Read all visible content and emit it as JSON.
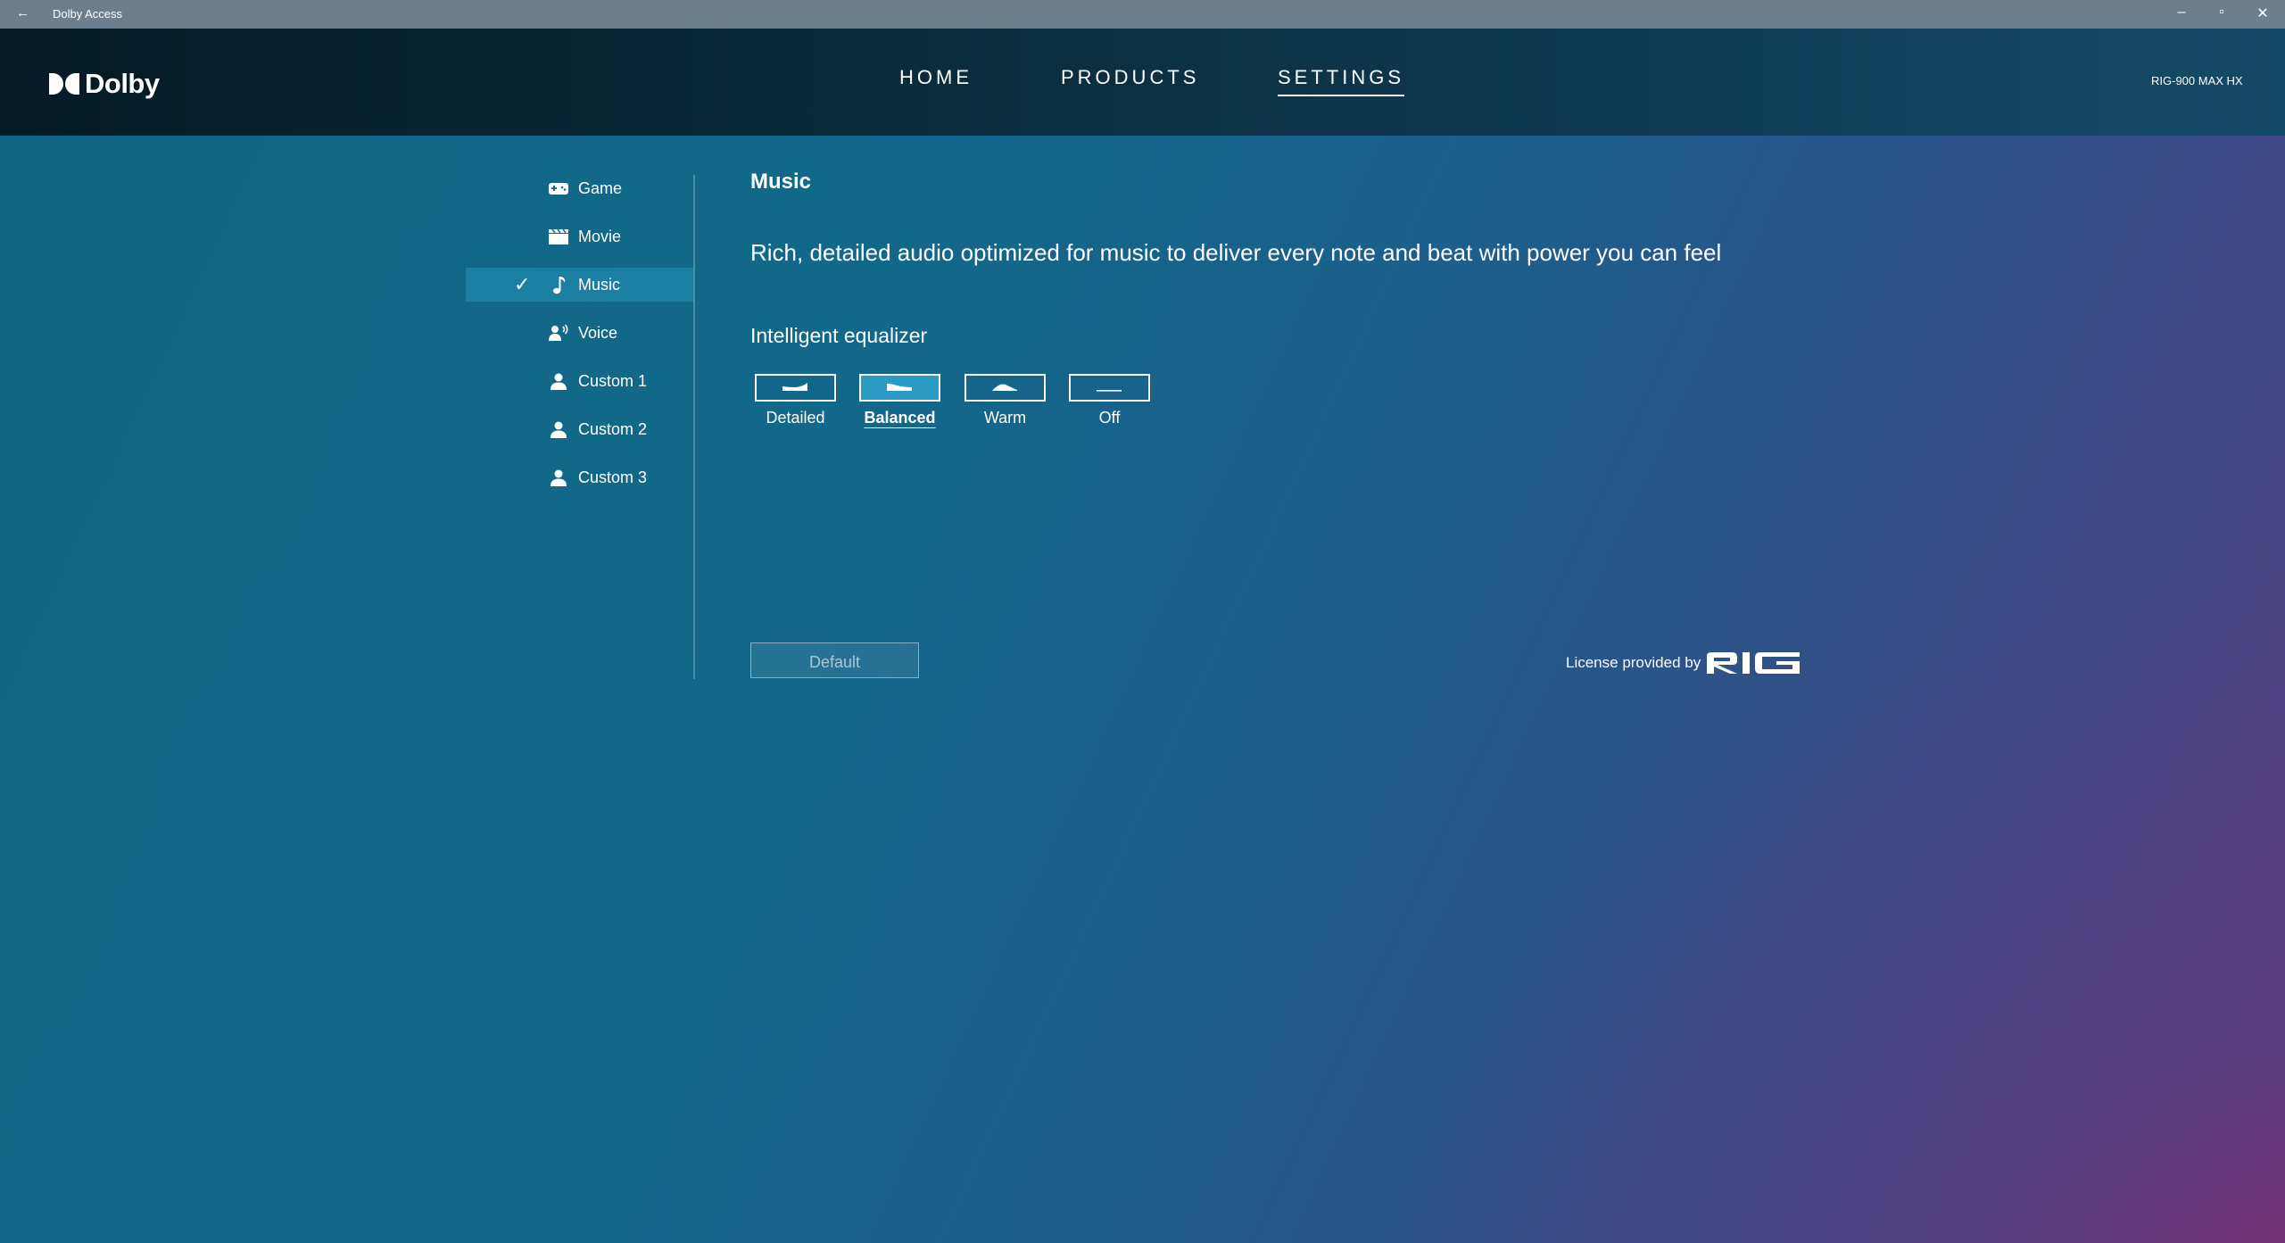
{
  "window": {
    "title": "Dolby Access",
    "back_glyph": "←",
    "minimize_glyph": "–",
    "restore_glyph": "▫",
    "close_glyph": "✕"
  },
  "header": {
    "logo_text": "Dolby",
    "nav": [
      {
        "label": "HOME",
        "active": false
      },
      {
        "label": "PRODUCTS",
        "active": false
      },
      {
        "label": "SETTINGS",
        "active": true
      }
    ],
    "device": "RIG-900 MAX HX"
  },
  "sidebar": {
    "items": [
      {
        "label": "Game",
        "icon": "gamepad-icon",
        "selected": false
      },
      {
        "label": "Movie",
        "icon": "clapperboard-icon",
        "selected": false
      },
      {
        "label": "Music",
        "icon": "music-note-icon",
        "selected": true
      },
      {
        "label": "Voice",
        "icon": "voice-icon",
        "selected": false
      },
      {
        "label": "Custom 1",
        "icon": "person-icon",
        "selected": false
      },
      {
        "label": "Custom 2",
        "icon": "person-icon",
        "selected": false
      },
      {
        "label": "Custom 3",
        "icon": "person-icon",
        "selected": false
      }
    ],
    "check_glyph": "✓"
  },
  "main": {
    "title": "Music",
    "description": "Rich, detailed audio optimized for music to deliver every note and beat with power you can feel",
    "equalizer": {
      "title": "Intelligent equalizer",
      "options": [
        {
          "label": "Detailed",
          "selected": false
        },
        {
          "label": "Balanced",
          "selected": true
        },
        {
          "label": "Warm",
          "selected": false
        },
        {
          "label": "Off",
          "selected": false
        }
      ]
    },
    "default_button": "Default",
    "license_text": "License provided by",
    "license_logo": "RIG"
  },
  "colors": {
    "selected_item_bg": "#1b7fa3",
    "selected_eq_bg": "#2a9bc4",
    "titlebar_bg": "#6d7f8c"
  }
}
